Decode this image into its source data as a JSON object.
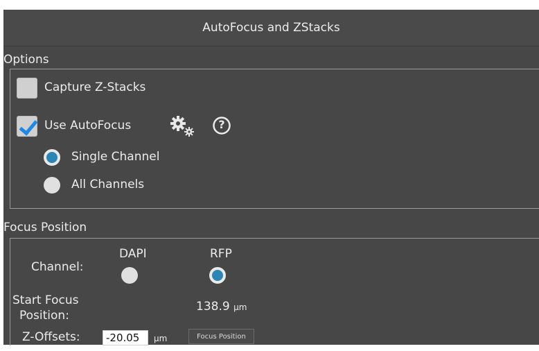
{
  "title": "AutoFocus and ZStacks",
  "options": {
    "label": "Options",
    "capture_zstacks": {
      "label": "Capture Z-Stacks",
      "checked": false
    },
    "use_autofocus": {
      "label": "Use AutoFocus",
      "checked": true
    },
    "settings_icon": "gears-icon",
    "help_icon": "help-icon",
    "help_symbol": "?",
    "single_channel": {
      "label": "Single Channel",
      "selected": true
    },
    "all_channels": {
      "label": "All Channels",
      "selected": false
    }
  },
  "focus_position": {
    "label": "Focus Position",
    "channel_label": "Channel:",
    "channels": [
      {
        "name": "DAPI",
        "selected": false
      },
      {
        "name": "RFP",
        "selected": true
      }
    ],
    "start_label_line1": "Start Focus",
    "start_label_line2": "Position:",
    "start_value": "138.9",
    "start_unit": "µm",
    "offsets_label": "Z-Offsets:",
    "offsets_value": "-20.05",
    "offsets_unit": "µm",
    "focus_button_label": "Focus Position"
  },
  "colors": {
    "panel_bg": "#474747",
    "accent_radio": "#2b86b6",
    "check_blue": "#1e88e5"
  }
}
